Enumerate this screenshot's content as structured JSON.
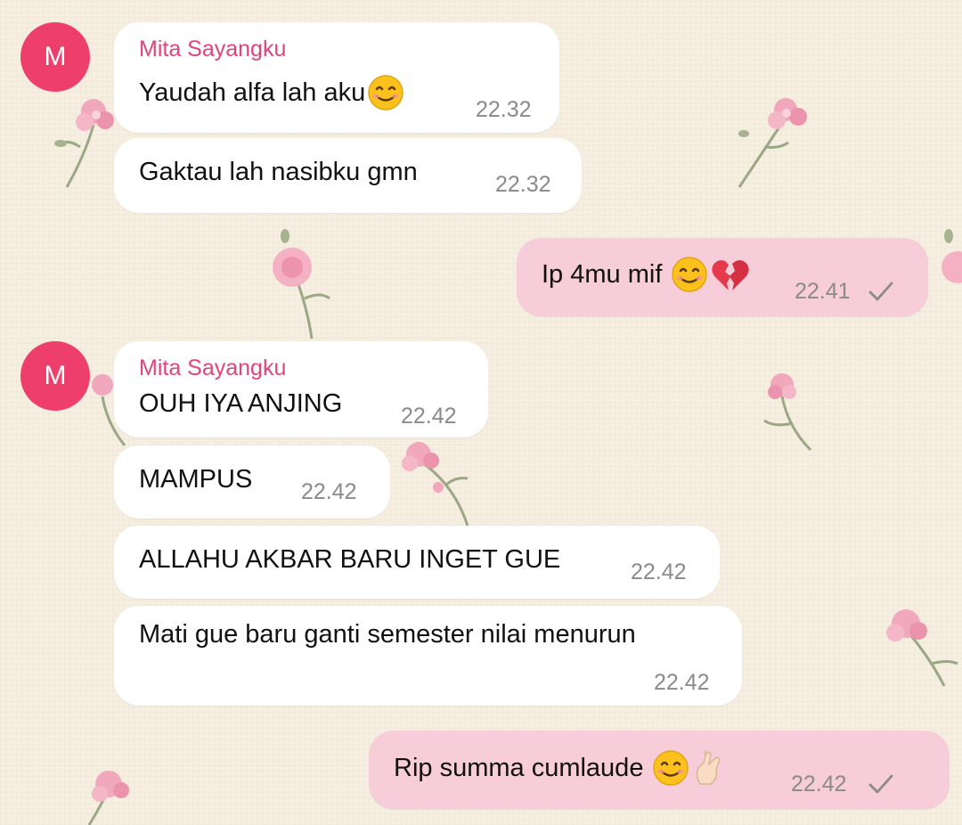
{
  "contact": {
    "name": "Mita Sayangku",
    "avatar_initial": "M"
  },
  "messages": [
    {
      "direction": "incoming",
      "text": "Yaudah alfa lah aku",
      "emoji": [
        "smiling-face-icon"
      ],
      "time": "22.32"
    },
    {
      "direction": "incoming",
      "text": "Gaktau lah nasibku gmn",
      "time": "22.32"
    },
    {
      "direction": "outgoing",
      "text": "Ip 4mu mif",
      "emoji": [
        "smiling-face-icon",
        "broken-heart-icon"
      ],
      "time": "22.41",
      "status": "sent"
    },
    {
      "direction": "incoming",
      "text": "OUH IYA ANJING",
      "time": "22.42"
    },
    {
      "direction": "incoming",
      "text": "MAMPUS",
      "time": "22.42"
    },
    {
      "direction": "incoming",
      "text": "ALLAHU AKBAR BARU INGET GUE",
      "time": "22.42"
    },
    {
      "direction": "incoming",
      "text": "Mati gue baru ganti semester nilai menurun",
      "time": "22.42"
    },
    {
      "direction": "outgoing",
      "text": "Rip summa cumlaude",
      "emoji": [
        "smiling-face-icon",
        "finger-heart-icon"
      ],
      "time": "22.42",
      "status": "sent"
    }
  ],
  "colors": {
    "background": "#f6efe1",
    "incoming_bubble": "#ffffff",
    "outgoing_bubble": "#f7cdd9",
    "sender_name": "#e0447a",
    "avatar": "#ee3f6c",
    "timestamp": "#8a8a8a"
  }
}
